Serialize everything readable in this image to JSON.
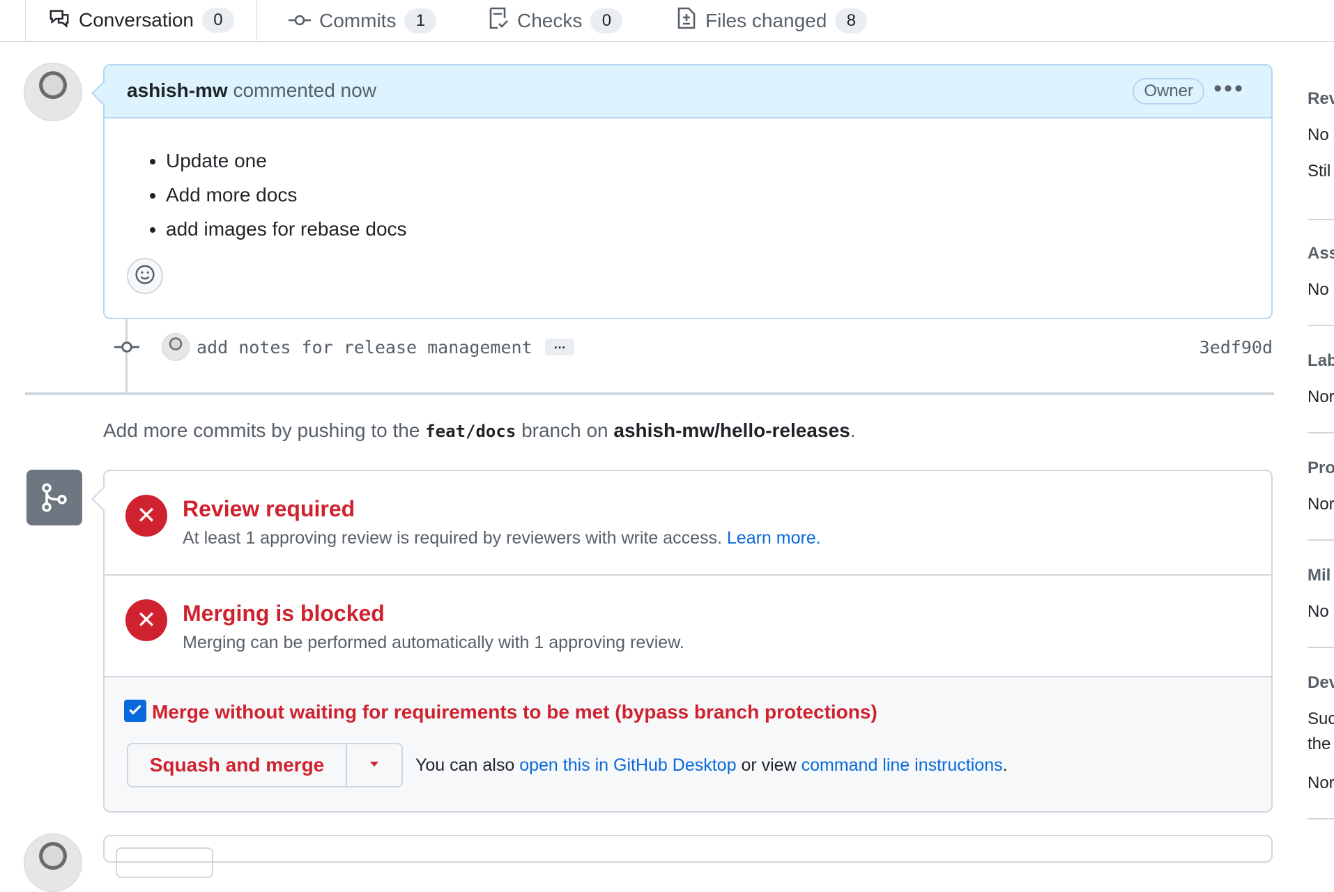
{
  "tabs": [
    {
      "label": "Conversation",
      "count": "0"
    },
    {
      "label": "Commits",
      "count": "1"
    },
    {
      "label": "Checks",
      "count": "0"
    },
    {
      "label": "Files changed",
      "count": "8"
    }
  ],
  "comment": {
    "author": "ashish-mw",
    "action": "commented now",
    "badge": "Owner",
    "items": [
      "Update one",
      "Add more docs",
      "add images for rebase docs"
    ]
  },
  "commit": {
    "message": "add notes for release management",
    "more": "…",
    "sha": "3edf90d"
  },
  "push_hint": {
    "prefix": "Add more commits by pushing to the",
    "branch": "feat/docs",
    "middle": "branch on",
    "repo": "ashish-mw/hello-releases",
    "suffix": "."
  },
  "merge": {
    "review_title": "Review required",
    "review_text": "At least 1 approving review is required by reviewers with write access.",
    "review_link": "Learn more.",
    "blocked_title": "Merging is blocked",
    "blocked_text": "Merging can be performed automatically with 1 approving review.",
    "bypass_label": "Merge without waiting for requirements to be met (bypass branch protections)",
    "bypass_checked": true,
    "button_label": "Squash and merge",
    "also_prefix": "You can also",
    "desktop_link": "open this in GitHub Desktop",
    "also_middle": "or view",
    "cli_link": "command line instructions",
    "also_suffix": "."
  },
  "sidebar": {
    "reviewers_head": "Rev",
    "reviewers_v1": "No",
    "reviewers_v2": "Stil",
    "assignees_head": "Ass",
    "assignees_v": "No",
    "labels_head": "Lab",
    "labels_v": "Nor",
    "projects_head": "Pro",
    "projects_v": "Nor",
    "milestone_head": "Mil",
    "milestone_v": "No",
    "dev_head": "Dev",
    "dev_v1": "Suc",
    "dev_v2": "the",
    "dev_v3": "Nor"
  },
  "colors": {
    "accent_blue": "#0969da",
    "danger": "#cf222e",
    "header_bg": "#ddf4ff"
  }
}
